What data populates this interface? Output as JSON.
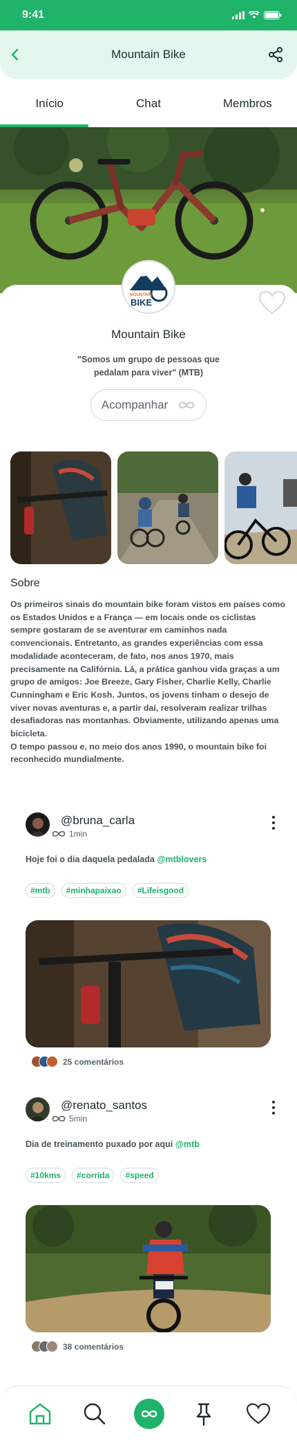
{
  "status_bar": {
    "time": "9:41"
  },
  "header": {
    "title": "Mountain Bike"
  },
  "tabs": [
    {
      "label": "Início"
    },
    {
      "label": "Chat"
    },
    {
      "label": "Membros"
    }
  ],
  "group": {
    "logo_top": "MOUNTAIN",
    "logo_bottom": "BIKE",
    "name": "Mountain Bike",
    "description": "\"Somos um grupo de pessoas que pedalam para viver\" (MTB)",
    "follow_label": "Acompanhar"
  },
  "about": {
    "title": "Sobre",
    "paragraphs": [
      "Os primeiros sinais do mountain bike foram vistos em países como os Estados Unidos e a França — em locais onde os ciclistas sempre gostaram de se aventurar em caminhos nada convencionais. Entretanto, as grandes experiências com essa modalidade aconteceram, de fato, nos anos 1970, mais precisamente na Califórnia. Lá, a prática ganhou vida graças a um grupo de amigos: Joe Breeze, Gary Fisher, Charlie Kelly, Charlie Cunningham e Eric Kosh. Juntos, os jovens tinham o desejo de viver novas aventuras e, a partir daí, resolveram realizar trilhas desafiadoras nas montanhas. Obviamente, utilizando apenas uma bicicleta.",
      "O tempo passou e, no meio dos anos 1990, o mountain bike foi reconhecido mundialmente."
    ]
  },
  "posts": [
    {
      "username": "@bruna_carla",
      "time": "1min",
      "text": "Hoje foi o dia daquela pedalada ",
      "mention": "@mtblovers",
      "tags": [
        "#mtb",
        "#minhapaixao",
        "#Lifeisgood"
      ],
      "comments": "25 comentários"
    },
    {
      "username": "@renato_santos",
      "time": "5min",
      "text": "Dia de treinamento puxado por aqui ",
      "mention": "@mtb",
      "tags": [
        "#10kms",
        "#corrida",
        "#speed"
      ],
      "comments": "38 comentários"
    }
  ],
  "nav": {
    "items": [
      "home-icon",
      "search-icon",
      "infinity-icon",
      "pin-icon",
      "heart-icon"
    ],
    "active": "infinity-icon"
  },
  "colors": {
    "accent": "#1fb36a",
    "header_bg": "#e4f7ec"
  }
}
